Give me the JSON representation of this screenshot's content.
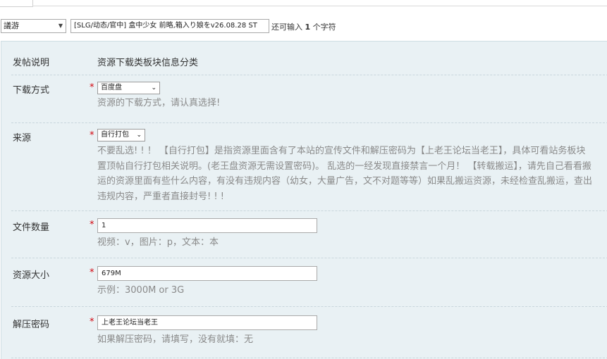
{
  "top_form": {
    "category_select": "議游",
    "title_value": "[SLG/动态/官中] 盒中少女 前略,箱入り娘をv26.08.28 ST",
    "counter_prefix": "还可输入",
    "counter_value": "1",
    "counter_suffix": "个字符"
  },
  "post_info": {
    "label": "发帖说明",
    "value": "资源下载类板块信息分类"
  },
  "download_method": {
    "label": "下载方式",
    "required_mark": "*",
    "selected": "百度盘",
    "hint": "资源的下载方式，请认真选择!"
  },
  "source": {
    "label": "来源",
    "required_mark": "*",
    "selected": "自行打包",
    "hint_lines": [
      "不要乱选! ! ！ 【自行打包】是指资源里面含有了本站的宣传文件和解压密码为【上老王论坛当老王】，具体可看站务板块",
      "置顶帖自行打包相关说明。(老王盘资源无需设置密码)。 乱选的一经发现直接禁言一个月！ 【转载搬运】，请先自己看看搬",
      "运的资源里面有些什么内容，有没有违规内容（幼女，大量广告，文不对题等等）如果乱搬运资源，未经检查乱搬运，查出",
      "违规内容，严重者直接封号! ! !"
    ]
  },
  "file_count": {
    "label": "文件数量",
    "required_mark": "*",
    "value": "1",
    "hint": "视频：v，图片：p，文本：本"
  },
  "resource_size": {
    "label": "资源大小",
    "required_mark": "*",
    "value": "679M",
    "hint": "示例：3000M or 3G"
  },
  "unzip_password": {
    "label": "解压密码",
    "required_mark": "*",
    "value": "上老王论坛当老王",
    "hint": "如果解压密码，请填写，没有就填：无"
  }
}
